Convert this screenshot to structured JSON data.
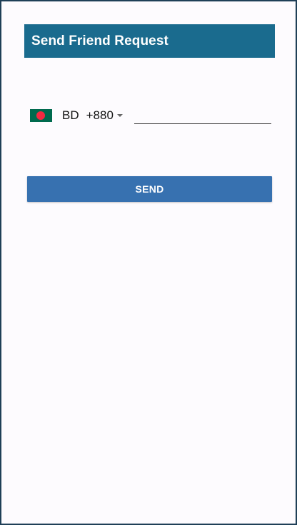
{
  "header": {
    "title": "Send Friend Request"
  },
  "phone": {
    "flag_icon": "bangladesh-flag-icon",
    "country_code": "BD",
    "dial_code": "+880",
    "number_value": "",
    "number_placeholder": ""
  },
  "actions": {
    "send_label": "SEND"
  },
  "colors": {
    "header_bg": "#1a6b8e",
    "button_bg": "#3771b0",
    "page_bg": "#fdfbfe",
    "flag_green": "#006a4e",
    "flag_red": "#f42a41"
  }
}
